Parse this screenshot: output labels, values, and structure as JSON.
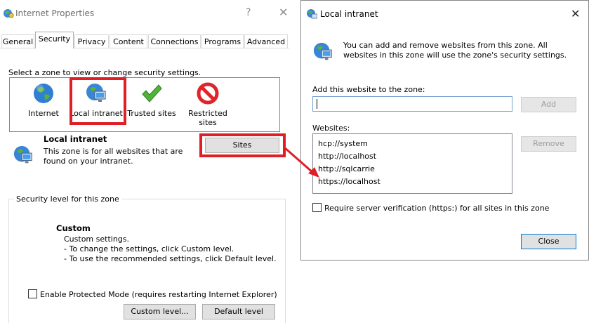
{
  "internet_properties": {
    "title": "Internet Properties",
    "help": "?",
    "close": "✕",
    "tabs": [
      "General",
      "Security",
      "Privacy",
      "Content",
      "Connections",
      "Programs",
      "Advanced"
    ],
    "zone_prompt": "Select a zone to view or change security settings.",
    "zones": [
      {
        "label": "Internet",
        "icon": "globe-icon"
      },
      {
        "label": "Local intranet",
        "icon": "network-monitor-icon"
      },
      {
        "label": "Trusted sites",
        "icon": "checkmark-icon"
      },
      {
        "label": "Restricted sites",
        "icon": "no-entry-icon"
      }
    ],
    "zone_title": "Local intranet",
    "zone_description": "This zone is for all websites that are found on your intranet.",
    "sites_button": "Sites",
    "security_level_legend": "Security level for this zone",
    "custom_title": "Custom",
    "custom_lines": [
      "Custom settings.",
      "- To change the settings, click Custom level.",
      "- To use the recommended settings, click Default level."
    ],
    "protected_mode_label": "Enable Protected Mode (requires restarting Internet Explorer)",
    "custom_level_button": "Custom level...",
    "default_level_button": "Default level"
  },
  "local_intranet_dialog": {
    "title": "Local intranet",
    "close": "✕",
    "info_text": "You can add and remove websites from this zone. All websites in this zone will use the zone's security settings.",
    "add_label": "Add this website to the zone:",
    "add_input_value": "",
    "add_button": "Add",
    "websites_label": "Websites:",
    "websites": [
      "hcp://system",
      "http://localhost",
      "http://sqlcarrie",
      "https://localhost"
    ],
    "remove_button": "Remove",
    "require_https_label": "Require server verification (https:) for all sites in this zone",
    "close_button": "Close"
  },
  "colors": {
    "annotation_red": "#e01e25",
    "focus_blue": "#0078d7"
  }
}
